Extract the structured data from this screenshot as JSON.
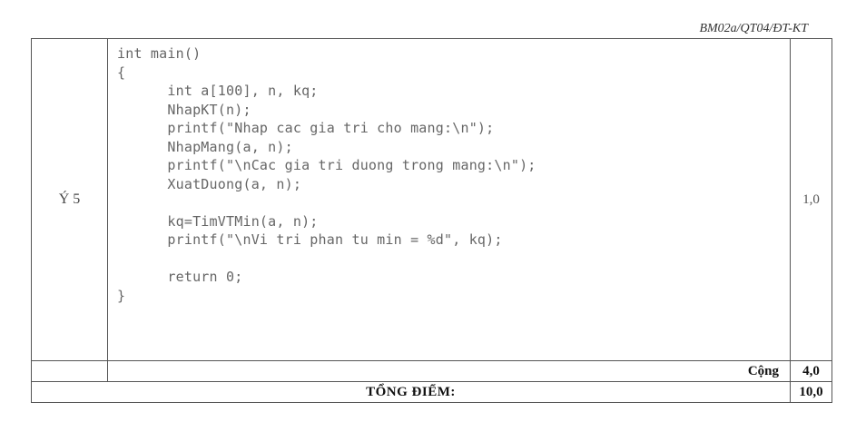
{
  "header": {
    "form_code": "BM02a/QT04/ĐT-KT"
  },
  "question": {
    "label": "Ý 5",
    "score": "1,0",
    "code_lines": [
      "int main()",
      "{",
      "      int a[100], n, kq;",
      "      NhapKT(n);",
      "      printf(\"Nhap cac gia tri cho mang:\\n\");",
      "      NhapMang(a, n);",
      "      printf(\"\\nCac gia tri duong trong mang:\\n\");",
      "      XuatDuong(a, n);",
      "",
      "      kq=TimVTMin(a, n);",
      "      printf(\"\\nVi tri phan tu min = %d\", kq);",
      "",
      "      return 0;",
      "}"
    ]
  },
  "subtotal": {
    "label": "Cộng",
    "value": "4,0"
  },
  "grand_total": {
    "label": "TỔNG ĐIỂM:",
    "value": "10,0"
  }
}
